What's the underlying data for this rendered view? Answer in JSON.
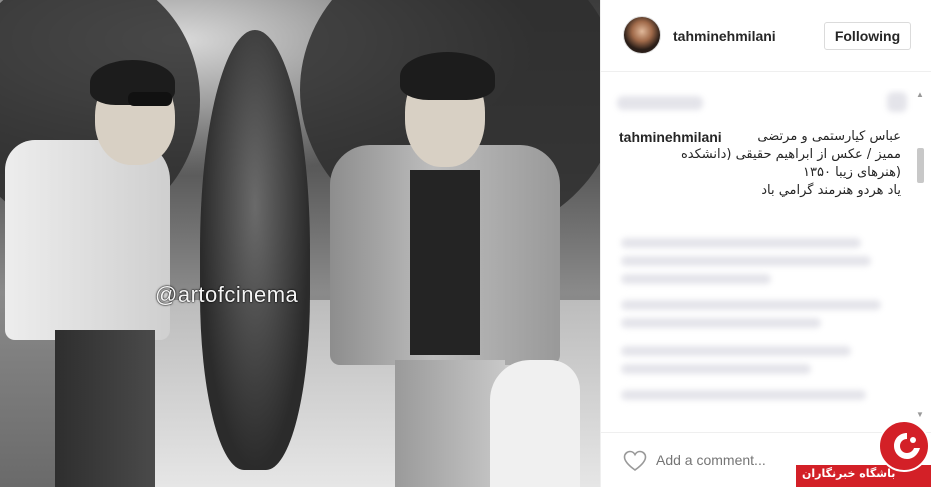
{
  "post": {
    "watermark": "@artofcinema"
  },
  "header": {
    "username": "tahminehmilani",
    "follow_label": "Following"
  },
  "caption": {
    "username": "tahminehmilani",
    "line1": "عباس کیارستمی و مرتضی",
    "line2": "ممیز / عکس از ابراهیم حقیقی (دانشکده",
    "line3": "(هنرهای زیبا ۱۳۵۰",
    "line4": "یاد هردو هنرمند گرامي باد"
  },
  "comment_bar": {
    "placeholder": "Add a comment..."
  },
  "badge": {
    "text": "باشگاه خبرنگاران"
  },
  "colors": {
    "badge_red": "#d32027",
    "text": "#262626",
    "muted": "#999999"
  },
  "icons": {
    "heart": "heart-icon",
    "scroll_up": "arrow-up-icon",
    "scroll_down": "arrow-down-icon"
  }
}
